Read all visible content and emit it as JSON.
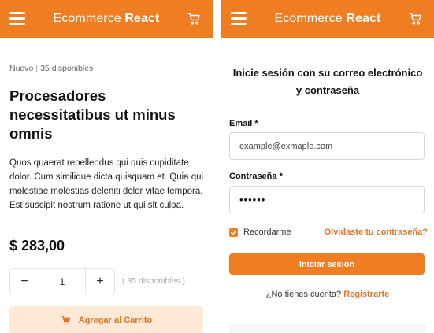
{
  "brand": {
    "light": "Ecommerce",
    "bold": "React"
  },
  "colors": {
    "accent": "#ef7d22",
    "accent_light": "#fde9d6",
    "link": "#e27321"
  },
  "icons": {
    "menu": "hamburger-icon",
    "cart": "cart-icon",
    "check": "check-icon"
  },
  "product": {
    "condition": "Nuevo",
    "separator": "|",
    "stock_text": "35 disponibles",
    "title": "Procesadores necessitatibus ut minus omnis",
    "description": "Quos quaerat repellendus qui quis cupiditate dolor. Cum similique dicta quisquam et. Quia qui molestiae molestias deleniti dolor vitae tempora. Est suscipit nostrum ratione ut qui sit culpa.",
    "price": "$ 283,00",
    "quantity": "1",
    "decrement": "−",
    "increment": "+",
    "availability": "( 35 disponibles )",
    "add_to_cart": "Agregar al Carrito"
  },
  "login": {
    "heading": "Inicie sesión con su correo electrónico y contraseña",
    "email_label": "Email *",
    "email_placeholder": "example@exmaple.com",
    "password_label": "Contraseña *",
    "password_value": "••••••",
    "remember": "Recordarme",
    "remember_checked": true,
    "forgot": "Olvidaste tu contraseña?",
    "submit": "Iniciar sesión",
    "no_account": "¿No tienes cuenta?",
    "register": "Registrarte"
  }
}
